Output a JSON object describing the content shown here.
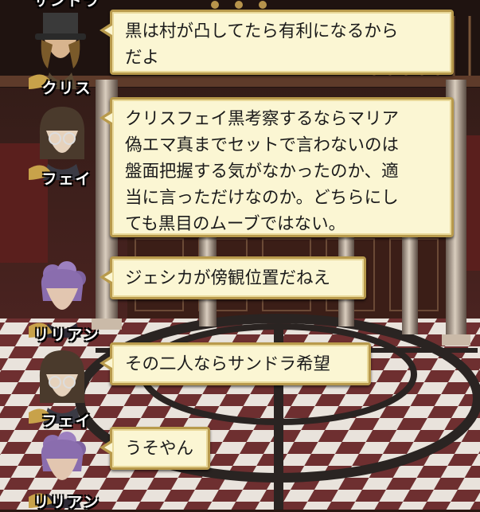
{
  "top_cut_name": "サンドラ",
  "messages": [
    {
      "speaker": "クリス",
      "avatar": "top-hat-man-avatar",
      "text": "黒は村が凸してたら有利になるから\nだよ"
    },
    {
      "speaker": "フェイ",
      "avatar": "glasses-woman-avatar",
      "text": "クリスフェイ黒考察するならマリア\n偽エマ真までセットで言わないのは\n盤面把握する気がなかったのか、適\n当に言っただけなのか。どちらにし\nても黒目のムーブではない。"
    },
    {
      "speaker": "リリアン",
      "avatar": "purple-hair-woman-avatar",
      "text": "ジェシカが傍観位置だねえ"
    },
    {
      "speaker": "フェイ",
      "avatar": "glasses-woman-avatar",
      "text": "その二人ならサンドラ希望"
    },
    {
      "speaker": "リリアン",
      "avatar": "purple-hair-woman-avatar",
      "text": "うそやん"
    }
  ],
  "colors": {
    "bubble_fill": "#fbf6d3",
    "bubble_border": "#b89a4c",
    "name_text": "#ffffff"
  }
}
